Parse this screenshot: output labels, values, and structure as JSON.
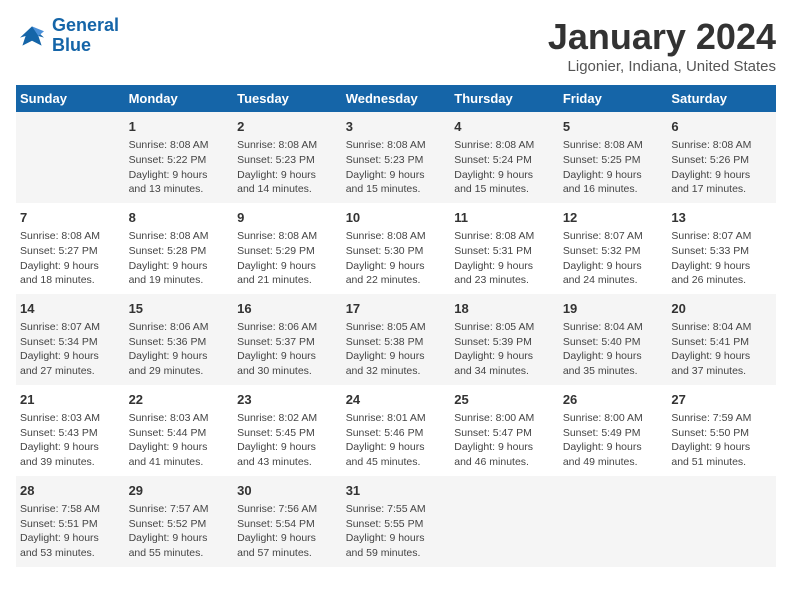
{
  "header": {
    "logo_line1": "General",
    "logo_line2": "Blue",
    "title": "January 2024",
    "subtitle": "Ligonier, Indiana, United States"
  },
  "columns": [
    "Sunday",
    "Monday",
    "Tuesday",
    "Wednesday",
    "Thursday",
    "Friday",
    "Saturday"
  ],
  "weeks": [
    [
      {
        "day": "",
        "info": ""
      },
      {
        "day": "1",
        "info": "Sunrise: 8:08 AM\nSunset: 5:22 PM\nDaylight: 9 hours\nand 13 minutes."
      },
      {
        "day": "2",
        "info": "Sunrise: 8:08 AM\nSunset: 5:23 PM\nDaylight: 9 hours\nand 14 minutes."
      },
      {
        "day": "3",
        "info": "Sunrise: 8:08 AM\nSunset: 5:23 PM\nDaylight: 9 hours\nand 15 minutes."
      },
      {
        "day": "4",
        "info": "Sunrise: 8:08 AM\nSunset: 5:24 PM\nDaylight: 9 hours\nand 15 minutes."
      },
      {
        "day": "5",
        "info": "Sunrise: 8:08 AM\nSunset: 5:25 PM\nDaylight: 9 hours\nand 16 minutes."
      },
      {
        "day": "6",
        "info": "Sunrise: 8:08 AM\nSunset: 5:26 PM\nDaylight: 9 hours\nand 17 minutes."
      }
    ],
    [
      {
        "day": "7",
        "info": "Sunrise: 8:08 AM\nSunset: 5:27 PM\nDaylight: 9 hours\nand 18 minutes."
      },
      {
        "day": "8",
        "info": "Sunrise: 8:08 AM\nSunset: 5:28 PM\nDaylight: 9 hours\nand 19 minutes."
      },
      {
        "day": "9",
        "info": "Sunrise: 8:08 AM\nSunset: 5:29 PM\nDaylight: 9 hours\nand 21 minutes."
      },
      {
        "day": "10",
        "info": "Sunrise: 8:08 AM\nSunset: 5:30 PM\nDaylight: 9 hours\nand 22 minutes."
      },
      {
        "day": "11",
        "info": "Sunrise: 8:08 AM\nSunset: 5:31 PM\nDaylight: 9 hours\nand 23 minutes."
      },
      {
        "day": "12",
        "info": "Sunrise: 8:07 AM\nSunset: 5:32 PM\nDaylight: 9 hours\nand 24 minutes."
      },
      {
        "day": "13",
        "info": "Sunrise: 8:07 AM\nSunset: 5:33 PM\nDaylight: 9 hours\nand 26 minutes."
      }
    ],
    [
      {
        "day": "14",
        "info": "Sunrise: 8:07 AM\nSunset: 5:34 PM\nDaylight: 9 hours\nand 27 minutes."
      },
      {
        "day": "15",
        "info": "Sunrise: 8:06 AM\nSunset: 5:36 PM\nDaylight: 9 hours\nand 29 minutes."
      },
      {
        "day": "16",
        "info": "Sunrise: 8:06 AM\nSunset: 5:37 PM\nDaylight: 9 hours\nand 30 minutes."
      },
      {
        "day": "17",
        "info": "Sunrise: 8:05 AM\nSunset: 5:38 PM\nDaylight: 9 hours\nand 32 minutes."
      },
      {
        "day": "18",
        "info": "Sunrise: 8:05 AM\nSunset: 5:39 PM\nDaylight: 9 hours\nand 34 minutes."
      },
      {
        "day": "19",
        "info": "Sunrise: 8:04 AM\nSunset: 5:40 PM\nDaylight: 9 hours\nand 35 minutes."
      },
      {
        "day": "20",
        "info": "Sunrise: 8:04 AM\nSunset: 5:41 PM\nDaylight: 9 hours\nand 37 minutes."
      }
    ],
    [
      {
        "day": "21",
        "info": "Sunrise: 8:03 AM\nSunset: 5:43 PM\nDaylight: 9 hours\nand 39 minutes."
      },
      {
        "day": "22",
        "info": "Sunrise: 8:03 AM\nSunset: 5:44 PM\nDaylight: 9 hours\nand 41 minutes."
      },
      {
        "day": "23",
        "info": "Sunrise: 8:02 AM\nSunset: 5:45 PM\nDaylight: 9 hours\nand 43 minutes."
      },
      {
        "day": "24",
        "info": "Sunrise: 8:01 AM\nSunset: 5:46 PM\nDaylight: 9 hours\nand 45 minutes."
      },
      {
        "day": "25",
        "info": "Sunrise: 8:00 AM\nSunset: 5:47 PM\nDaylight: 9 hours\nand 46 minutes."
      },
      {
        "day": "26",
        "info": "Sunrise: 8:00 AM\nSunset: 5:49 PM\nDaylight: 9 hours\nand 49 minutes."
      },
      {
        "day": "27",
        "info": "Sunrise: 7:59 AM\nSunset: 5:50 PM\nDaylight: 9 hours\nand 51 minutes."
      }
    ],
    [
      {
        "day": "28",
        "info": "Sunrise: 7:58 AM\nSunset: 5:51 PM\nDaylight: 9 hours\nand 53 minutes."
      },
      {
        "day": "29",
        "info": "Sunrise: 7:57 AM\nSunset: 5:52 PM\nDaylight: 9 hours\nand 55 minutes."
      },
      {
        "day": "30",
        "info": "Sunrise: 7:56 AM\nSunset: 5:54 PM\nDaylight: 9 hours\nand 57 minutes."
      },
      {
        "day": "31",
        "info": "Sunrise: 7:55 AM\nSunset: 5:55 PM\nDaylight: 9 hours\nand 59 minutes."
      },
      {
        "day": "",
        "info": ""
      },
      {
        "day": "",
        "info": ""
      },
      {
        "day": "",
        "info": ""
      }
    ]
  ]
}
